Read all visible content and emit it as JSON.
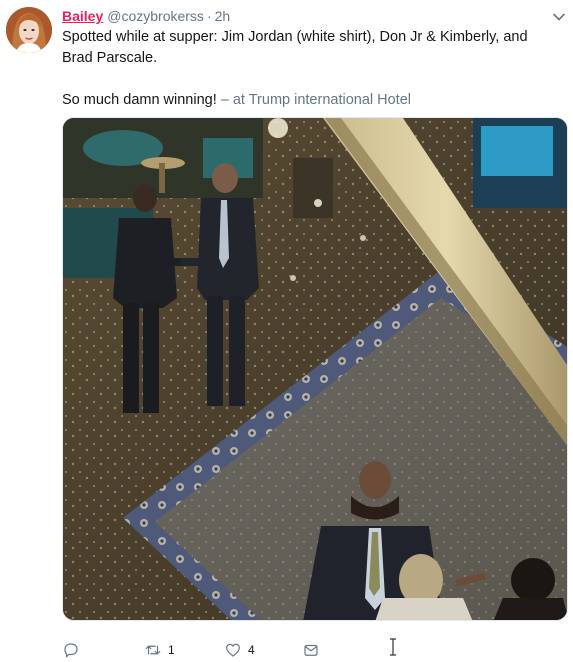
{
  "tweet": {
    "author_name": "Bailey",
    "author_handle": "@cozybrokerss",
    "separator": "·",
    "timestamp": "2h",
    "text_line_1": "Spotted while at supper: Jim Jordan (white shirt), Don Jr & Kimberly, and Brad Parscale.",
    "text_line_2": "So much damn winning!",
    "location_prefix": " – at ",
    "location_name": "Trump international Hotel",
    "media_description_icon": "photo",
    "name_color": "#e0245e",
    "muted_color": "#657786"
  },
  "actions": {
    "reply_icon": "reply-icon",
    "retweet_icon": "retweet-icon",
    "retweet_count": "1",
    "like_icon": "heart-icon",
    "like_count": "4",
    "dm_icon": "envelope-icon"
  }
}
